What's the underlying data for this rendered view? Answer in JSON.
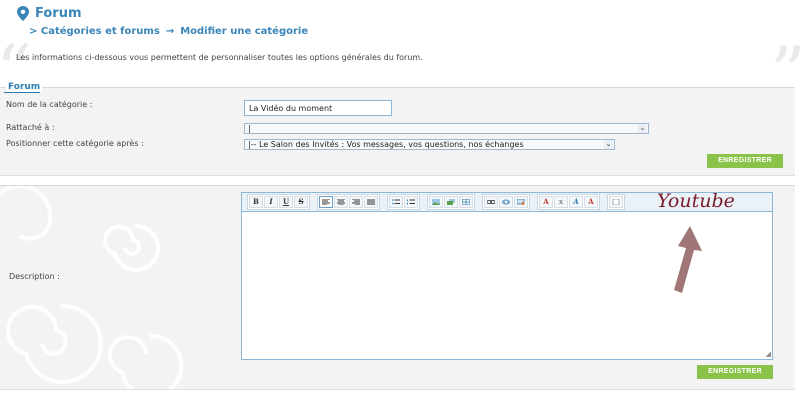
{
  "header": {
    "title": "Forum",
    "breadcrumb": [
      {
        "label": "> Catégories et forums"
      },
      {
        "label": "→"
      },
      {
        "label": "Modifier une catégorie"
      }
    ]
  },
  "intro": "Les informations ci-dessous vous permettent de personnaliser toutes les options générales du forum.",
  "section_forum": {
    "legend": "Forum",
    "fields": {
      "name_label": "Nom de la catégorie :",
      "name_value": "La Vidéo du moment",
      "parent_label": "Rattaché à :",
      "parent_value": "|",
      "position_label": "Positionner cette catégorie après :",
      "position_value": "|-- Le Salon des Invités : Vos messages, vos questions, nos échanges"
    },
    "save_label": "ENREGISTRER"
  },
  "section_description": {
    "label": "Description :",
    "save_label": "ENREGISTRER"
  },
  "annotation": {
    "text": "Youtube",
    "color": "#7a1a2a"
  },
  "colors": {
    "accent": "#3a86b8",
    "save_button": "#8bc34a",
    "arrow": "#a07676"
  }
}
